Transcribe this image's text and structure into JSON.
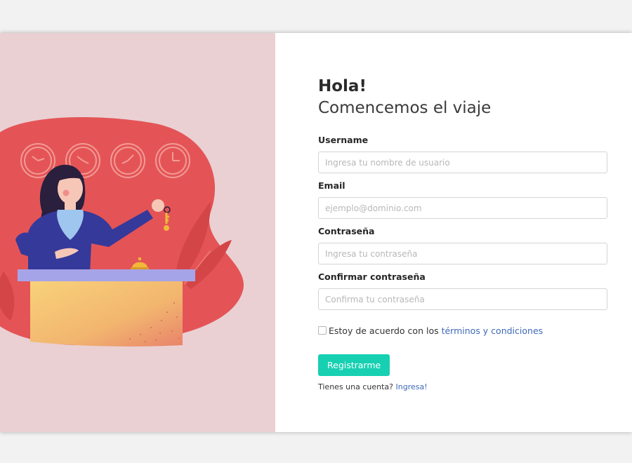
{
  "greeting": "Hola!",
  "subtitle": "Comencemos el viaje",
  "fields": [
    {
      "label": "Username",
      "placeholder": "Ingresa tu nombre de usuario",
      "value": ""
    },
    {
      "label": "Email",
      "placeholder": "ejemplo@dominio.com",
      "value": ""
    },
    {
      "label": "Contraseña",
      "placeholder": "Ingresa tu contraseña",
      "value": ""
    },
    {
      "label": "Confirmar contraseña",
      "placeholder": "Confirma tu contraseña",
      "value": ""
    }
  ],
  "terms": {
    "checked": false,
    "text": "Estoy de acuerdo con los",
    "link_text": "términos y condiciones"
  },
  "submit_label": "Registrarme",
  "login_prompt": {
    "text": "Tienes una cuenta?",
    "link_text": "Ingresa!"
  },
  "colors": {
    "accent": "#17d0b2",
    "link": "#3d6ab8",
    "illustration_background": "#ead0d3",
    "illustration_blob": "#e45456"
  }
}
